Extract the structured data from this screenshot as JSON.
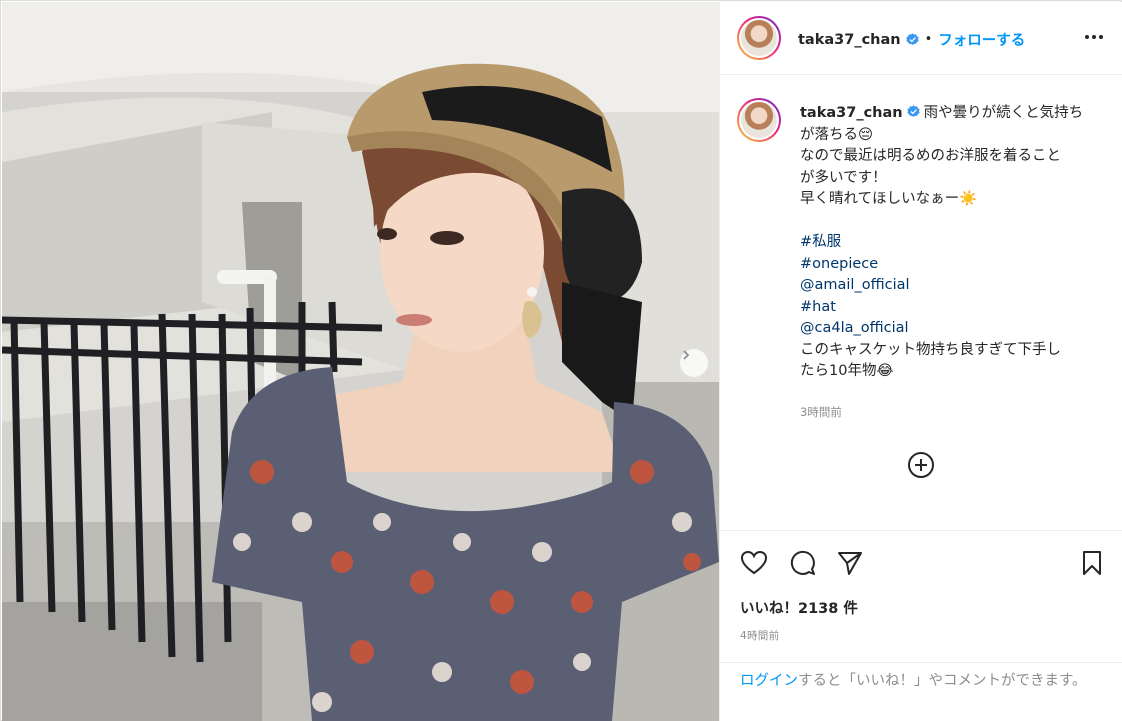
{
  "post": {
    "username": "taka37_chan",
    "header_dot": "•",
    "follow_label": "フォローする",
    "more_icon": "more-horizontal-icon",
    "caption": {
      "username": "taka37_chan",
      "text_first": "雨や曇りが続くと気持ち",
      "lines": [
        "が落ちる😔",
        "なので最近は明るめのお洋服を着ること",
        "が多いです！",
        "早く晴れてほしいなぁー☀️"
      ],
      "tags": [
        "#私服",
        "#onepiece",
        "@amail_official",
        "#hat",
        "@ca4la_official"
      ],
      "tail_lines": [
        "このキャスケット物持ち良すぎて下手し",
        "たら10年物😂"
      ],
      "time": "3時間前"
    },
    "likes_text": "いいね！2138 件",
    "post_time": "4時間前",
    "login": {
      "link": "ログイン",
      "rest": "すると「いいね！」やコメントができます。"
    },
    "icons": {
      "like": "heart-icon",
      "comment": "comment-icon",
      "share": "paper-plane-icon",
      "save": "bookmark-icon",
      "load_more": "plus-circle-icon",
      "verified": "verified-badge-icon",
      "next": "chevron-right-icon"
    },
    "colors": {
      "accent": "#0095f6",
      "hashtag": "#00376b",
      "muted": "#8e8e8e",
      "text": "#262626"
    }
  }
}
